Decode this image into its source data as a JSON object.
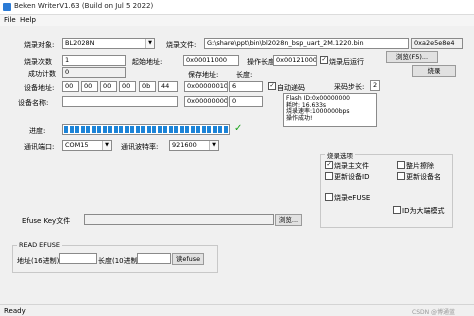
{
  "window": {
    "title": "Beken WriterV1.63 (Build on Jul  5 2022)"
  },
  "menu": {
    "file": "File",
    "help": "Help"
  },
  "form": {
    "target_label": "烧录对象:",
    "target_value": "BL2028N",
    "file_label": "烧录文件:",
    "file_value": "G:\\share\\ppt\\bin\\bl2028n_bsp_uart_2M.1220.bin",
    "checksum_value": "0xa2e5e8e4",
    "browse_label": "浏览(F5)...",
    "burn_label": "烧录",
    "count_label": "烧录次数",
    "count_value": "1",
    "start_addr_label": "起始地址:",
    "start_addr_value": "0x00011000",
    "op_len_label": "操作长度:",
    "op_len_value": "0x00121000",
    "reset_after_label": "烧录后运行",
    "success_count_label": "成功计数",
    "success_count_value": "0",
    "save_addr_label": "保存地址:",
    "length_label": "长度:",
    "device_addr_label": "设备地址:",
    "device_addr": [
      "00",
      "00",
      "00",
      "00",
      "0b",
      "44"
    ],
    "save_addr_value": "0x0000001000",
    "length_value": "6",
    "auto_inc_label": "自动递码",
    "step_label": "采码步长:",
    "step_value": "2",
    "device_name_label": "设备名称:",
    "save_addr2_value": "0x00000000",
    "length2_value": "0"
  },
  "log": {
    "lines": [
      "Flash ID:0x00000000",
      "耗时: 16.633s",
      "烧录速率:1000000bps",
      "操作成功!"
    ]
  },
  "progress": {
    "label": "进度:",
    "value": 1.0
  },
  "serial": {
    "port_label": "通讯端口:",
    "port_value": "COM15",
    "baud_label": "通讯波特率:",
    "baud_value": "921600"
  },
  "options": {
    "group_title": "烧录选项",
    "main_file": "烧录主文件",
    "update_device_id": "更新设备ID",
    "whole_erase": "整片擦除",
    "update_device_name": "更新设备名",
    "burn_efuse": "烧录eFUSE",
    "id_big_endian": "ID为大端模式"
  },
  "efuse": {
    "key_label": "Efuse Key文件",
    "browse_label": "浏览..."
  },
  "read_efuse": {
    "group_title": "READ EFUSE",
    "addr_label": "地址(16进制):",
    "len_label": "长度(10进制):",
    "button_label": "读efuse"
  },
  "status": {
    "text": "Ready"
  },
  "watermark": "CSDN @博通蓝"
}
